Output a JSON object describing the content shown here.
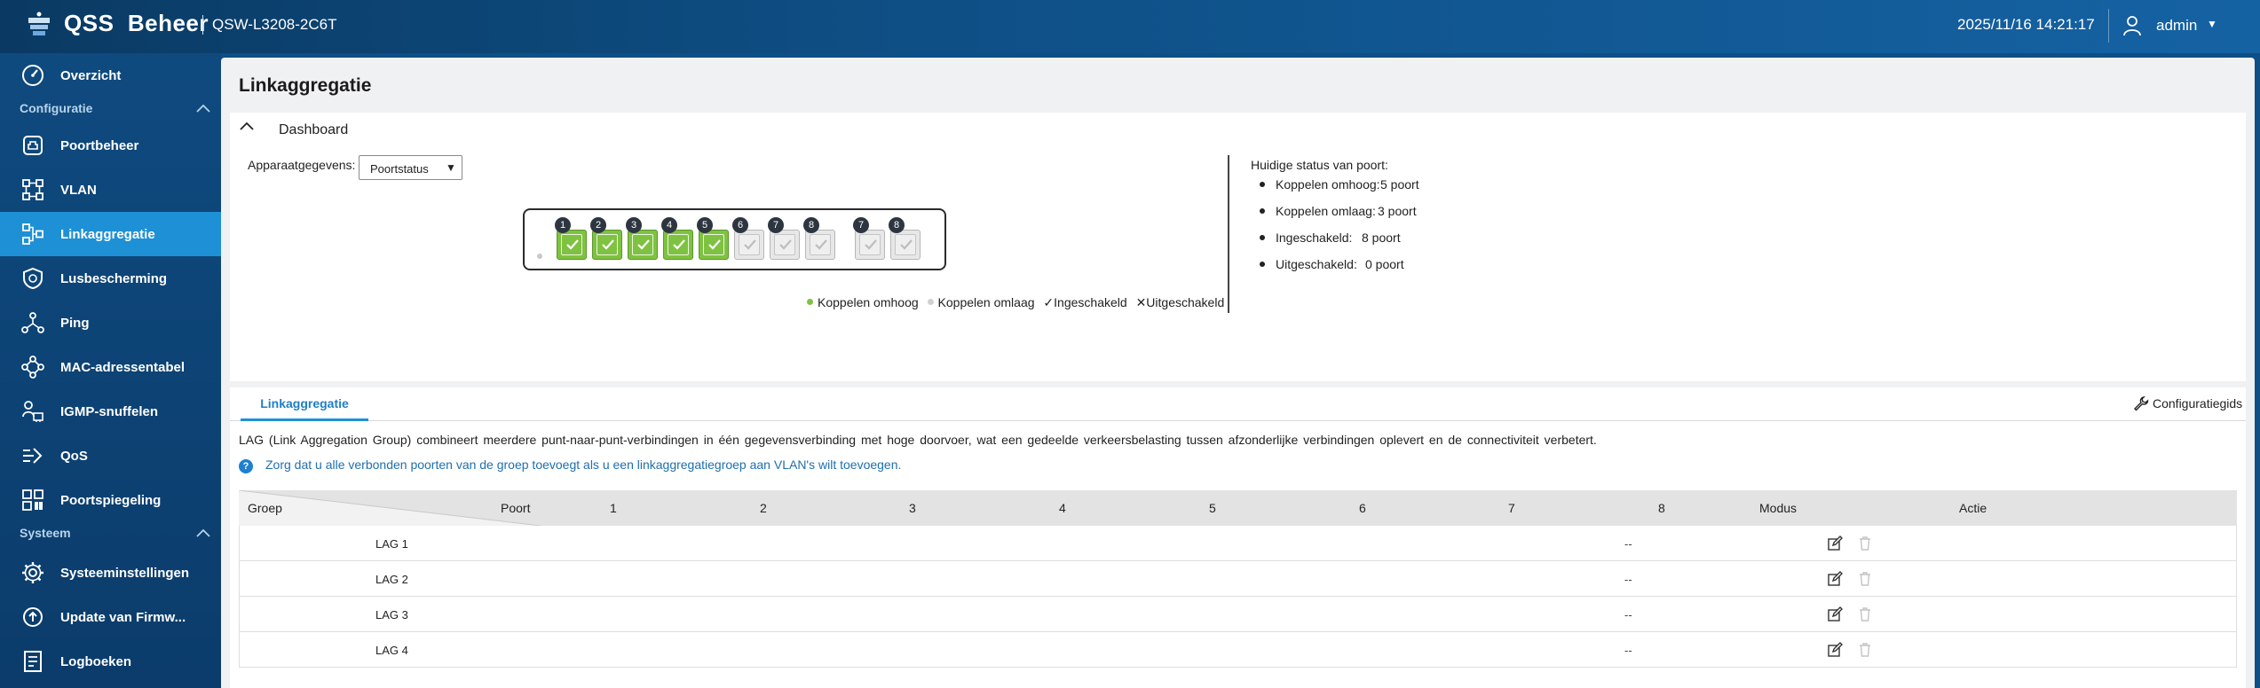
{
  "header": {
    "brand": "QSS  Beheer",
    "model": "QSW-L3208-2C6T",
    "datetime": "2025/11/16  14:21:17",
    "user": "admin",
    "accent_color": "#1e90d6"
  },
  "sidebar": {
    "overview": "Overzicht",
    "section_config": "Configuratie",
    "section_system": "Systeem",
    "items": [
      {
        "label": "Poortbeheer",
        "icon": "port-icon"
      },
      {
        "label": "VLAN",
        "icon": "vlan-icon"
      },
      {
        "label": "Linkaggregatie",
        "icon": "link-aggregation-icon",
        "active": true
      },
      {
        "label": "Lusbescherming",
        "icon": "shield-icon"
      },
      {
        "label": "Ping",
        "icon": "ping-icon"
      },
      {
        "label": "MAC-adressentabel",
        "icon": "mac-table-icon"
      },
      {
        "label": "IGMP-snuffelen",
        "icon": "igmp-icon"
      },
      {
        "label": "QoS",
        "icon": "qos-icon"
      },
      {
        "label": "Poortspiegeling",
        "icon": "mirror-icon"
      }
    ],
    "system_items": [
      {
        "label": "Systeeminstellingen",
        "icon": "gear-icon"
      },
      {
        "label": "Update van Firmw...",
        "icon": "update-icon"
      },
      {
        "label": "Logboeken",
        "icon": "log-icon"
      }
    ]
  },
  "main": {
    "title": "Linkaggregatie",
    "dashboard": {
      "title": "Dashboard",
      "device_label": "Apparaatgegevens:",
      "device_select": "Poortstatus",
      "ports": [
        {
          "num": "1",
          "state": "up"
        },
        {
          "num": "2",
          "state": "up"
        },
        {
          "num": "3",
          "state": "up"
        },
        {
          "num": "4",
          "state": "up"
        },
        {
          "num": "5",
          "state": "up"
        },
        {
          "num": "6",
          "state": "down"
        },
        {
          "num": "7",
          "state": "down"
        },
        {
          "num": "8",
          "state": "down"
        },
        {
          "num": "7",
          "state": "down"
        },
        {
          "num": "8",
          "state": "down"
        }
      ],
      "legend": {
        "up": "Koppelen  omhoog",
        "down": "Koppelen  omlaag",
        "enabled": "Ingeschakeld",
        "disabled": "Uitgeschakeld",
        "up_color": "#7fc241",
        "down_color": "#d0d0d0"
      },
      "status_title": "Huidige  status  van  poort:",
      "status": [
        {
          "label": "Koppelen  omhoog:",
          "value": "5  poort"
        },
        {
          "label": "Koppelen  omlaag:",
          "value": "3  poort"
        },
        {
          "label": "Ingeschakeld:",
          "value": "8  poort"
        },
        {
          "label": "Uitgeschakeld:",
          "value": "0  poort"
        }
      ]
    },
    "tab": "Linkaggregatie",
    "config_guide": "Configuratiegids",
    "description": "LAG (Link Aggregation Group) combineert meerdere punt-naar-punt-verbindingen in één gegevensverbinding met hoge doorvoer, wat een gedeelde verkeersbelasting tussen afzonderlijke verbindingen oplevert en de connectiviteit verbetert.",
    "note": "Zorg dat u alle verbonden poorten van de groep toevoegt als u een linkaggregatiegroep aan VLAN's wilt toevoegen.",
    "table": {
      "col_group": "Groep",
      "col_port": "Poort",
      "port_cols": [
        "1",
        "2",
        "3",
        "4",
        "5",
        "6",
        "7",
        "8"
      ],
      "col_mode": "Modus",
      "col_action": "Actie",
      "rows": [
        {
          "name": "LAG  1",
          "mode": "--"
        },
        {
          "name": "LAG  2",
          "mode": "--"
        },
        {
          "name": "LAG  3",
          "mode": "--"
        },
        {
          "name": "LAG  4",
          "mode": "--"
        }
      ]
    }
  }
}
